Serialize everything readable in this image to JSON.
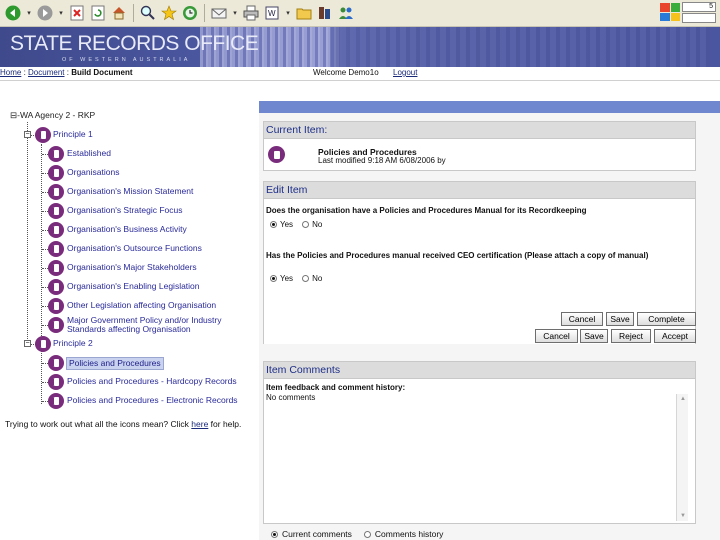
{
  "toolbar": {
    "back_icon": "back-arrow-icon",
    "forward_icon": "forward-arrow-icon",
    "zoom_label": "5"
  },
  "banner": {
    "title": "STATE RECORDS OFFICE",
    "subtitle": "OF WESTERN AUSTRALIA"
  },
  "nav": {
    "home": "Home",
    "document": "Document",
    "current": "Build Document",
    "welcome": "Welcome Demo1o",
    "logout": "Logout"
  },
  "tree": {
    "root": "⊟-WA Agency 2 - RKP",
    "principle1": "Principle 1",
    "p1_items": [
      "Established",
      "Organisations",
      "Organisation's Mission Statement",
      "Organisation's Strategic Focus",
      "Organisation's Business Activity",
      "Organisation's Outsource Functions",
      "Organisation's Major Stakeholders",
      "Organisation's Enabling Legislation",
      "Other Legislation affecting Organisation",
      "Major Government Policy and/or Industry Standards affecting Organisation"
    ],
    "principle2": "Principle 2",
    "p2_items": [
      "Policies and Procedures",
      "Policies and Procedures - Hardcopy Records",
      "Policies and Procedures - Electronic Records"
    ]
  },
  "help": {
    "text_before": "Trying to work out what all the icons mean? Click ",
    "link": "here",
    "text_after": " for help."
  },
  "current_item": {
    "heading": "Current Item:",
    "title": "Policies and Procedures",
    "modified": "Last modified 9:18 AM 6/08/2006 by"
  },
  "edit_item": {
    "heading": "Edit Item",
    "q1": "Does the organisation have a Policies and Procedures Manual for its Recordkeeping",
    "q2": "Has the Policies and Procedures manual received CEO certification (Please attach a copy of manual)",
    "yes": "Yes",
    "no": "No",
    "q1_selected": "Yes",
    "q2_selected": "Yes",
    "buttons_row1": [
      "Cancel",
      "Save",
      "Complete"
    ],
    "buttons_row2": [
      "Cancel",
      "Save",
      "Reject",
      "Accept"
    ]
  },
  "comments": {
    "heading": "Item Comments",
    "label": "Item feedback and comment history:",
    "text": "No comments",
    "opt_current": "Current comments",
    "opt_history": "Comments history",
    "selected": "Current comments"
  }
}
